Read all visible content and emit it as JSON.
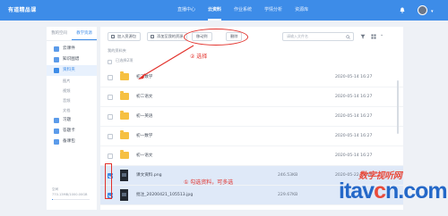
{
  "app": {
    "brand": "有道精品课"
  },
  "nav": [
    "直播中心",
    "云资料",
    "作业系统",
    "学情分析",
    "资源库"
  ],
  "nav_active": 1,
  "sidebar": {
    "tabs": [
      "我的空间",
      "教学资源"
    ],
    "items": [
      {
        "label": "云课件",
        "icon": "cloud-icon"
      },
      {
        "label": "知识图谱",
        "icon": "graph-icon"
      },
      {
        "label": "资料夹",
        "icon": "folder-icon",
        "active": true
      },
      {
        "label": "习题",
        "icon": "exercise-icon"
      },
      {
        "label": "答题卡",
        "icon": "card-icon"
      },
      {
        "label": "备课包",
        "icon": "package-icon"
      }
    ],
    "subitems": [
      "图片",
      "视频",
      "音频",
      "文档"
    ],
    "storage_label": "空间",
    "storage_value": "770.13MB/1000.00GB",
    "storage_fraction": 0.01
  },
  "toolbar": {
    "upload": "加入资源包",
    "link": "添加至我的资源",
    "move": "移动到",
    "delete": "删除",
    "search_placeholder": "请输入文件名"
  },
  "breadcrumb": "我的资料夹",
  "selected_count": "已选择2项",
  "files": [
    {
      "type": "folder",
      "name": "初二数学",
      "size": "",
      "date": "2020-05-14 16:27",
      "selected": false
    },
    {
      "type": "folder",
      "name": "初二语文",
      "size": "",
      "date": "2020-05-14 16:27",
      "selected": false
    },
    {
      "type": "folder",
      "name": "初一英语",
      "size": "",
      "date": "2020-05-14 16:27",
      "selected": false
    },
    {
      "type": "folder",
      "name": "初一数学",
      "size": "",
      "date": "2020-05-14 16:27",
      "selected": false
    },
    {
      "type": "folder",
      "name": "初一语文",
      "size": "",
      "date": "2020-05-14 16:27",
      "selected": false
    },
    {
      "type": "image",
      "name": "课文资料.png",
      "size": "246.53KB",
      "date": "2020-05-22 11:50",
      "selected": true
    },
    {
      "type": "image",
      "name": "批注_20200421_105513.jpg",
      "size": "229.67KB",
      "date": "",
      "selected": true
    }
  ],
  "annotations": {
    "step1": "① 勾选资料，可多选",
    "step2": "② 选择"
  },
  "watermark": {
    "top": "数字视听网",
    "logo_a": "itav",
    "logo_o": "c",
    "logo_b": "n.com"
  },
  "colors": {
    "primary": "#3d8ce8",
    "annotation_red": "#e2312b",
    "folder_yellow": "#f6c042",
    "selected_row": "#dfe9f8"
  }
}
